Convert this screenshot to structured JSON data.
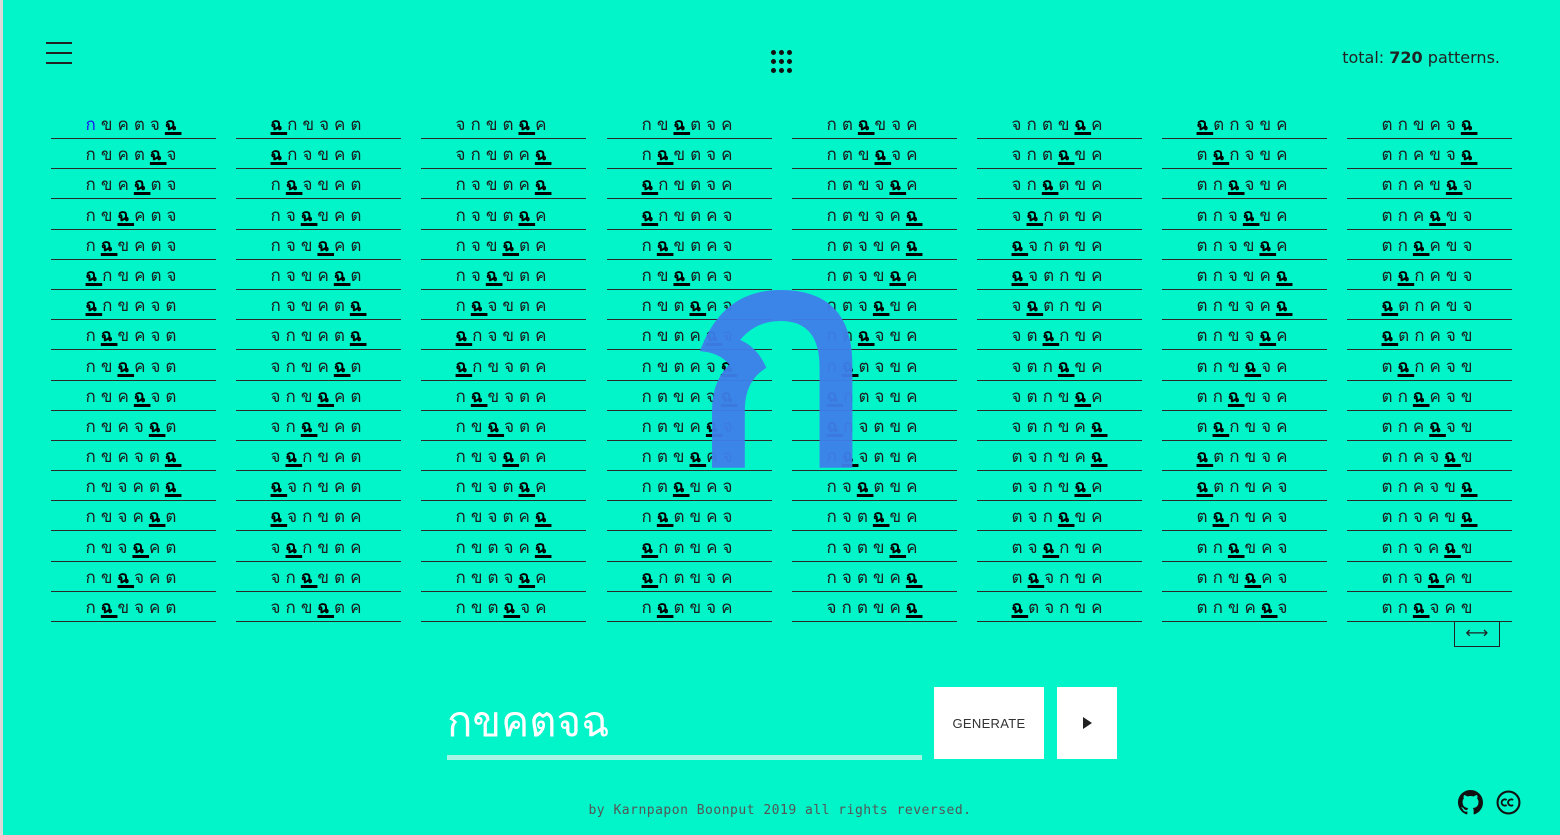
{
  "header": {
    "menu_icon": "hamburger-icon",
    "apps_icon": "grid-dots-icon",
    "total_prefix": "total:",
    "total_count": "720",
    "total_suffix": "patterns."
  },
  "big_glyph": "ก",
  "columns": [
    [
      "กขคตจฉ",
      "กขคตฉจ",
      "กขคฉตจ",
      "กขฉคตจ",
      "กฉขคตจ",
      "ฉกขคตจ",
      "ฉกขคจต",
      "กฉขคจต",
      "กขฉคจต",
      "กขคฉจต",
      "กขคจฉต",
      "กขคจตฉ",
      "กขจคตฉ",
      "กขจคฉต",
      "กขจฉคต",
      "กขฉจคต",
      "กฉขจคต"
    ],
    [
      "ฉกขจคต",
      "ฉกจขคต",
      "กฉจขคต",
      "กจฉขคต",
      "กจขฉคต",
      "กจขคฉต",
      "กจขคตฉ",
      "จกขคตฉ",
      "จกขคฉต",
      "จกขฉคต",
      "จกฉขคต",
      "จฉกขคต",
      "ฉจกขคต",
      "ฉจกขตค",
      "จฉกขตค",
      "จกฉขตค",
      "จกขฉตค"
    ],
    [
      "จกขตฉค",
      "จกขตคฉ",
      "กจขตคฉ",
      "กจขตฉค",
      "กจขฉตค",
      "กจฉขตค",
      "กฉจขตค",
      "ฉกจขตค",
      "ฉกขจตค",
      "กฉขจตค",
      "กขฉจตค",
      "กขจฉตค",
      "กขจตฉค",
      "กขจตคฉ",
      "กขตจคฉ",
      "กขตจฉค",
      "กขตฉจค"
    ],
    [
      "กขฉตจค",
      "กฉขตจค",
      "ฉกขตจค",
      "ฉกขตคจ",
      "กฉขตคจ",
      "กขฉตคจ",
      "กขตฉคจ",
      "กขตคฉจ",
      "กขตคจฉ",
      "กตขคจฉ",
      "กตขคฉจ",
      "กตขฉคจ",
      "กตฉขคจ",
      "กฉตขคจ",
      "ฉกตขคจ",
      "ฉกตขจค",
      "กฉตขจค"
    ],
    [
      "กตฉขจค",
      "กตขฉจค",
      "กตขจฉค",
      "กตขจคฉ",
      "กตจขคฉ",
      "กตจขฉค",
      "กตจฉขค",
      "กตฉจขค",
      "กฉตจขค",
      "ฉกตจขค",
      "ฉกจตขค",
      "กฉจตขค",
      "กจฉตขค",
      "กจตฉขค",
      "กจตขฉค",
      "กจตขคฉ",
      "จกตขคฉ"
    ],
    [
      "จกตขฉค",
      "จกตฉขค",
      "จกฉตขค",
      "จฉกตขค",
      "ฉจกตขค",
      "ฉจตกขค",
      "จฉตกขค",
      "จตฉกขค",
      "จตกฉขค",
      "จตกขฉค",
      "จตกขคฉ",
      "ตจกขคฉ",
      "ตจกขฉค",
      "ตจกฉขค",
      "ตจฉกขค",
      "ตฉจกขค",
      "ฉตจกขค"
    ],
    [
      "ฉตกจขค",
      "ตฉกจขค",
      "ตกฉจขค",
      "ตกจฉขค",
      "ตกจขฉค",
      "ตกจขคฉ",
      "ตกขจคฉ",
      "ตกขจฉค",
      "ตกขฉจค",
      "ตกฉขจค",
      "ตฉกขจค",
      "ฉตกขจค",
      "ฉตกขคจ",
      "ตฉกขคจ",
      "ตกฉขคจ",
      "ตกขฉคจ",
      "ตกขคฉจ"
    ],
    [
      "ตกขคจฉ",
      "ตกคขจฉ",
      "ตกคขฉจ",
      "ตกคฉขจ",
      "ตกฉคขจ",
      "ตฉกคขจ",
      "ฉตกคขจ",
      "ฉตกคจข",
      "ตฉกคจข",
      "ตกฉคจข",
      "ตกคฉจข",
      "ตกคจฉข",
      "ตกคจขฉ",
      "ตกจคขฉ",
      "ตกจคฉข",
      "ตกจฉคข",
      "ตกฉจคข"
    ]
  ],
  "highlight_char": "ฉ",
  "swap_label": "⟷",
  "input": {
    "value": "กขคตจฉ",
    "placeholder": ""
  },
  "generate_label": "GENERATE",
  "play_icon": "play-icon",
  "footer_text": "by Karnpapon Boonput 2019 all rights reversed.",
  "social": {
    "github_icon": "github-icon",
    "cc_icon": "creative-commons-icon"
  },
  "colors": {
    "background": "#02f4c9",
    "glyph": "#3f80ea",
    "first_letter": "#1a1aee"
  }
}
